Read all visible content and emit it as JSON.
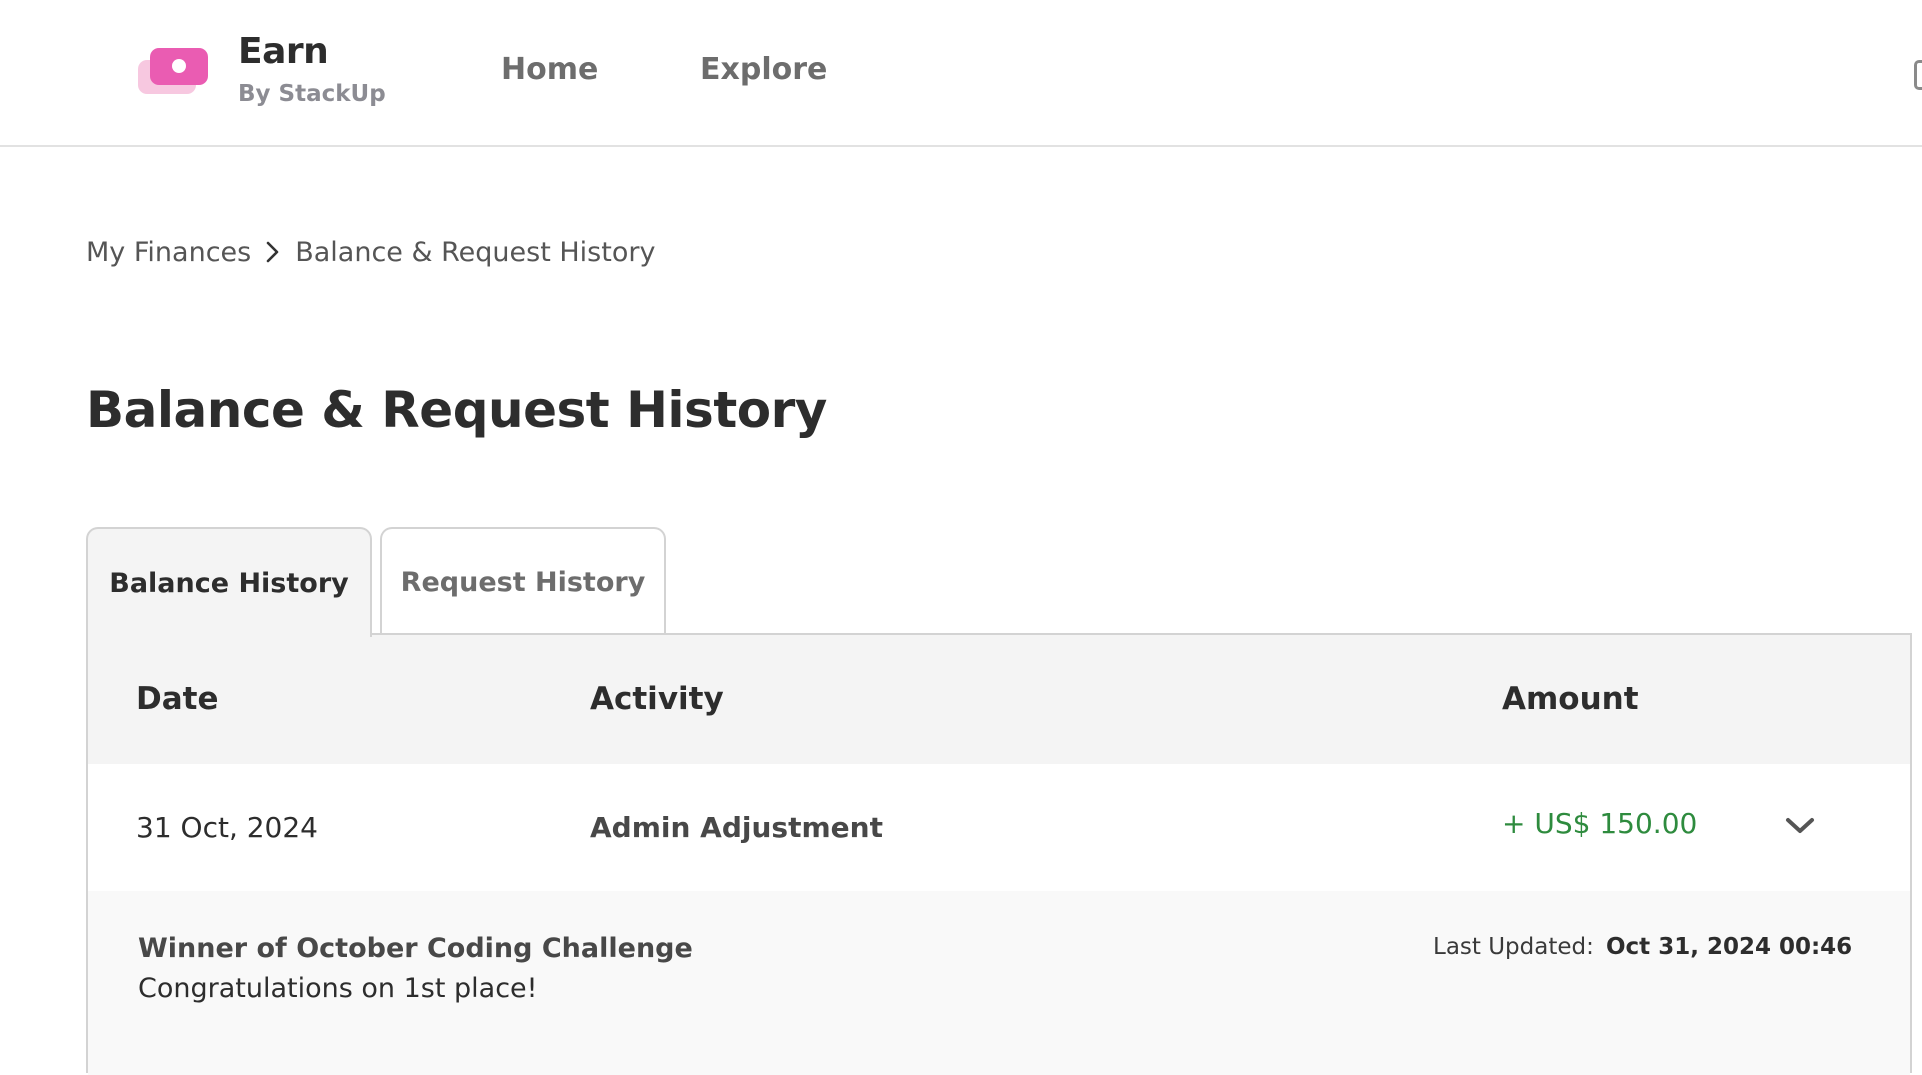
{
  "header": {
    "brand_title": "Earn",
    "brand_subtitle": "By StackUp",
    "nav": [
      {
        "label": "Home"
      },
      {
        "label": "Explore"
      }
    ],
    "logo_colors": {
      "front": "#ea5cb2",
      "back": "#f7c8e0"
    }
  },
  "breadcrumb": {
    "items": [
      {
        "label": "My Finances"
      },
      {
        "label": "Balance & Request History"
      }
    ],
    "separator_icon": "chevron-right-icon"
  },
  "page": {
    "title": "Balance & Request History"
  },
  "tabs": [
    {
      "label": "Balance History",
      "active": true
    },
    {
      "label": "Request History",
      "active": false
    }
  ],
  "table": {
    "columns": [
      "Date",
      "Activity",
      "Amount"
    ],
    "rows": [
      {
        "date": "31 Oct, 2024",
        "activity": "Admin Adjustment",
        "amount": "+ US$ 150.00",
        "expanded": true,
        "toggle_icon": "chevron-down-icon",
        "detail": {
          "title": "Winner of October Coding Challenge",
          "note": "Congratulations on 1st place!",
          "updated_label": "Last Updated:",
          "updated_value": "Oct 31, 2024 00:46"
        }
      }
    ]
  },
  "colors": {
    "positive_amount": "#2e8b3e",
    "header_bg": "#f4f4f4",
    "detail_bg": "#f9f9f9"
  }
}
